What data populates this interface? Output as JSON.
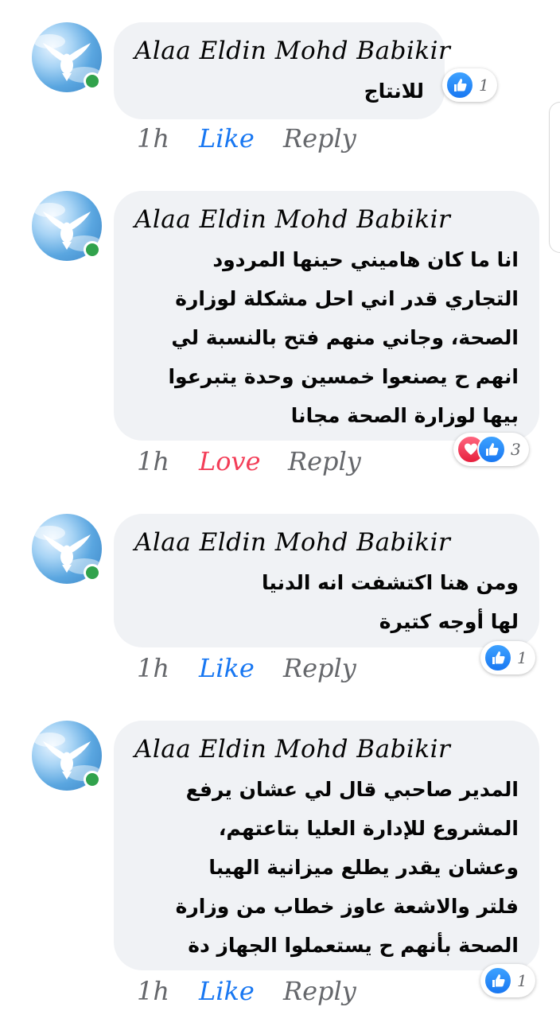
{
  "comments": [
    {
      "author": "Alaa Eldin Mohd Babikir",
      "text": "للانتاج",
      "time": "1h",
      "action": "Like",
      "reply": "Reply",
      "reaction_count": "1"
    },
    {
      "author": "Alaa Eldin Mohd Babikir",
      "text": "انا ما كان هاميني حينها المردود التجاري قدر اني احل مشكلة لوزارة الصحة، وجاني منهم فتح بالنسبة لي انهم ح يصنعوا خمسين وحدة يتبرعوا بيها لوزارة الصحة مجانا",
      "time": "1h",
      "action": "Love",
      "reply": "Reply",
      "reaction_count": "3"
    },
    {
      "author": "Alaa Eldin Mohd Babikir",
      "text": "ومن هنا اكتشفت انه الدنيا لها أوجه كتيرة",
      "time": "1h",
      "action": "Like",
      "reply": "Reply",
      "reaction_count": "1"
    },
    {
      "author": "Alaa Eldin Mohd Babikir",
      "text": "المدير صاحبي قال لي عشان يرفع المشروع للإدارة العليا بتاعتهم، وعشان يقدر يطلع ميزانية الهيبا فلتر والاشعة عاوز خطاب من وزارة الصحة بأنهم ح يستعملوا الجهاز دة",
      "time": "1h",
      "action": "Like",
      "reply": "Reply",
      "reaction_count": "1"
    }
  ],
  "icons": {
    "avatar": "dove-on-sky-avatar",
    "online": "online-status-dot",
    "like": "thumbs-up-icon",
    "love": "heart-icon"
  },
  "colors": {
    "like_blue": "#1877f2",
    "love_red": "#f33e58",
    "online_green": "#31a24c",
    "bubble_gray": "#f0f2f5",
    "meta_gray": "#65676b"
  }
}
